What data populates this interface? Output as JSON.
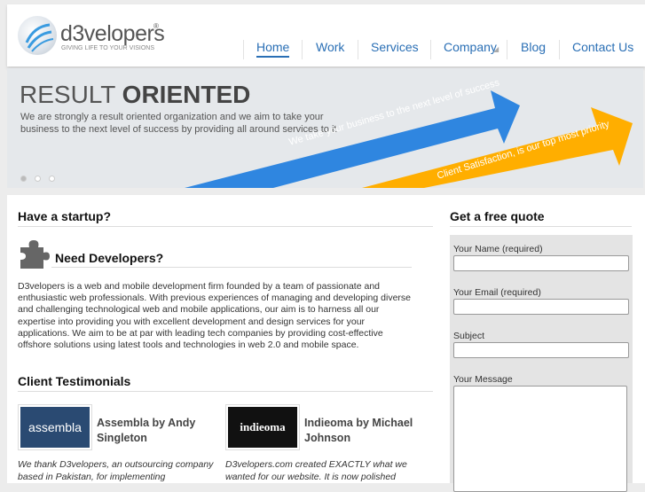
{
  "header": {
    "logo_text": "d3velopers",
    "logo_reg": "®",
    "tagline": "GIVING LIFE TO YOUR VISIONS",
    "nav": [
      {
        "label": "Home"
      },
      {
        "label": "Work"
      },
      {
        "label": "Services"
      },
      {
        "label": "Company"
      },
      {
        "label": "Blog"
      },
      {
        "label": "Contact Us"
      }
    ]
  },
  "banner": {
    "title_light": "RESULT ",
    "title_bold": "ORIENTED",
    "text": "We are strongly a result oriented organization and we aim to take your business to the next level of success by providing all around services to it",
    "arrow1": "We take your business to the next level of success",
    "arrow2": "Client Satisfaction, is our top most priority",
    "colors": {
      "blue": "#2f86e0",
      "orange": "#ffae00"
    }
  },
  "startup": {
    "heading": "Have a startup?",
    "subheading": "Need Developers?",
    "body": "D3velopers is a web and mobile development firm founded by a team of passionate and enthusiastic web professionals. With previous experiences of managing and developing diverse and challenging technological web and mobile applications, our aim is to harness all our expertise into providing you with excellent development and design services for your applications. We aim to be at par with leading tech companies by providing cost-effective offshore solutions using latest tools and technologies in web 2.0 and mobile space."
  },
  "testimonials": {
    "heading": "Client Testimonials",
    "items": [
      {
        "logo": "assembla",
        "name": "Assembla by Andy Singleton",
        "quote": "We thank D3velopers, an outsourcing company based in Pakistan, for implementing"
      },
      {
        "logo": "indieoma",
        "name": "Indieoma by Michael Johnson",
        "quote": "D3velopers.com created EXACTLY what we wanted for our website. It is now polished"
      }
    ]
  },
  "quote": {
    "heading": "Get a free quote",
    "fields": [
      {
        "label": "Your Name (required)",
        "value": ""
      },
      {
        "label": "Your Email (required)",
        "value": ""
      },
      {
        "label": "Subject",
        "value": ""
      },
      {
        "label": "Your Message",
        "value": ""
      }
    ]
  }
}
